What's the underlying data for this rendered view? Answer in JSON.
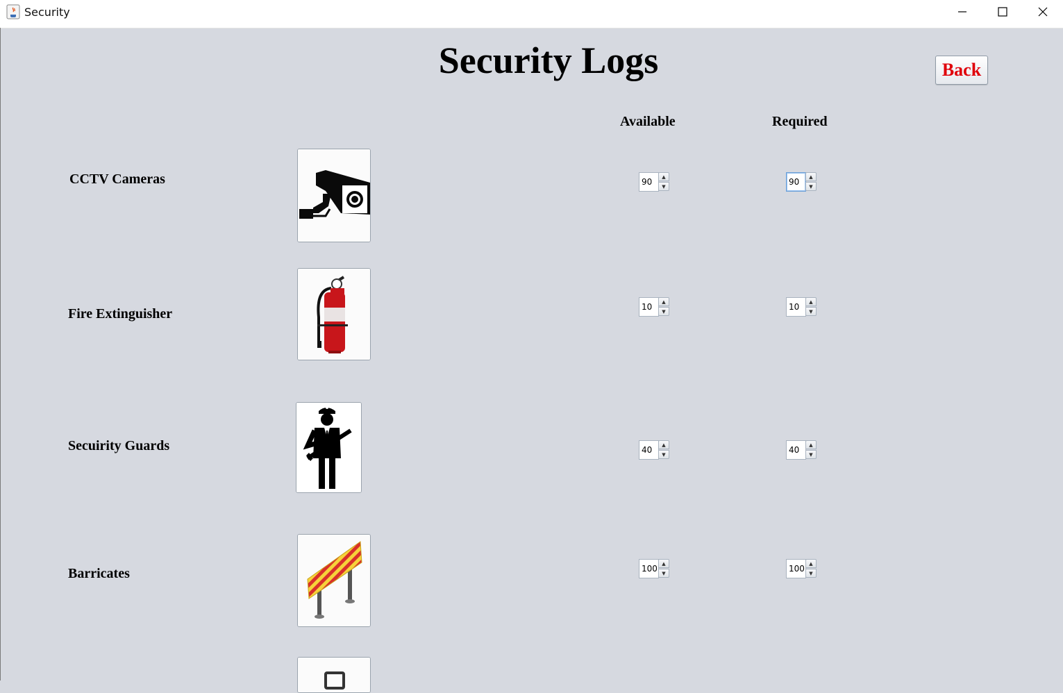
{
  "window": {
    "title": "Security",
    "minimize_icon": "minimize-icon",
    "maximize_icon": "maximize-icon",
    "close_icon": "close-icon"
  },
  "page": {
    "title": "Security Logs",
    "back_label": "Back",
    "back_color": "#e0000a",
    "background": "#d6d9e0"
  },
  "columns": {
    "available": "Available",
    "required": "Required"
  },
  "items": [
    {
      "label": "CCTV Cameras",
      "icon": "cctv-camera-icon",
      "available": "90",
      "required": "90",
      "required_focused": true
    },
    {
      "label": "Fire Extinguisher",
      "icon": "fire-extinguisher-icon",
      "available": "10",
      "required": "10"
    },
    {
      "label": "Secuirity Guards",
      "icon": "security-guard-icon",
      "available": "40",
      "required": "40"
    },
    {
      "label": "Barricates",
      "icon": "barricade-icon",
      "available": "100",
      "required": "100"
    },
    {
      "label": "",
      "icon": "partial-item-icon"
    }
  ]
}
